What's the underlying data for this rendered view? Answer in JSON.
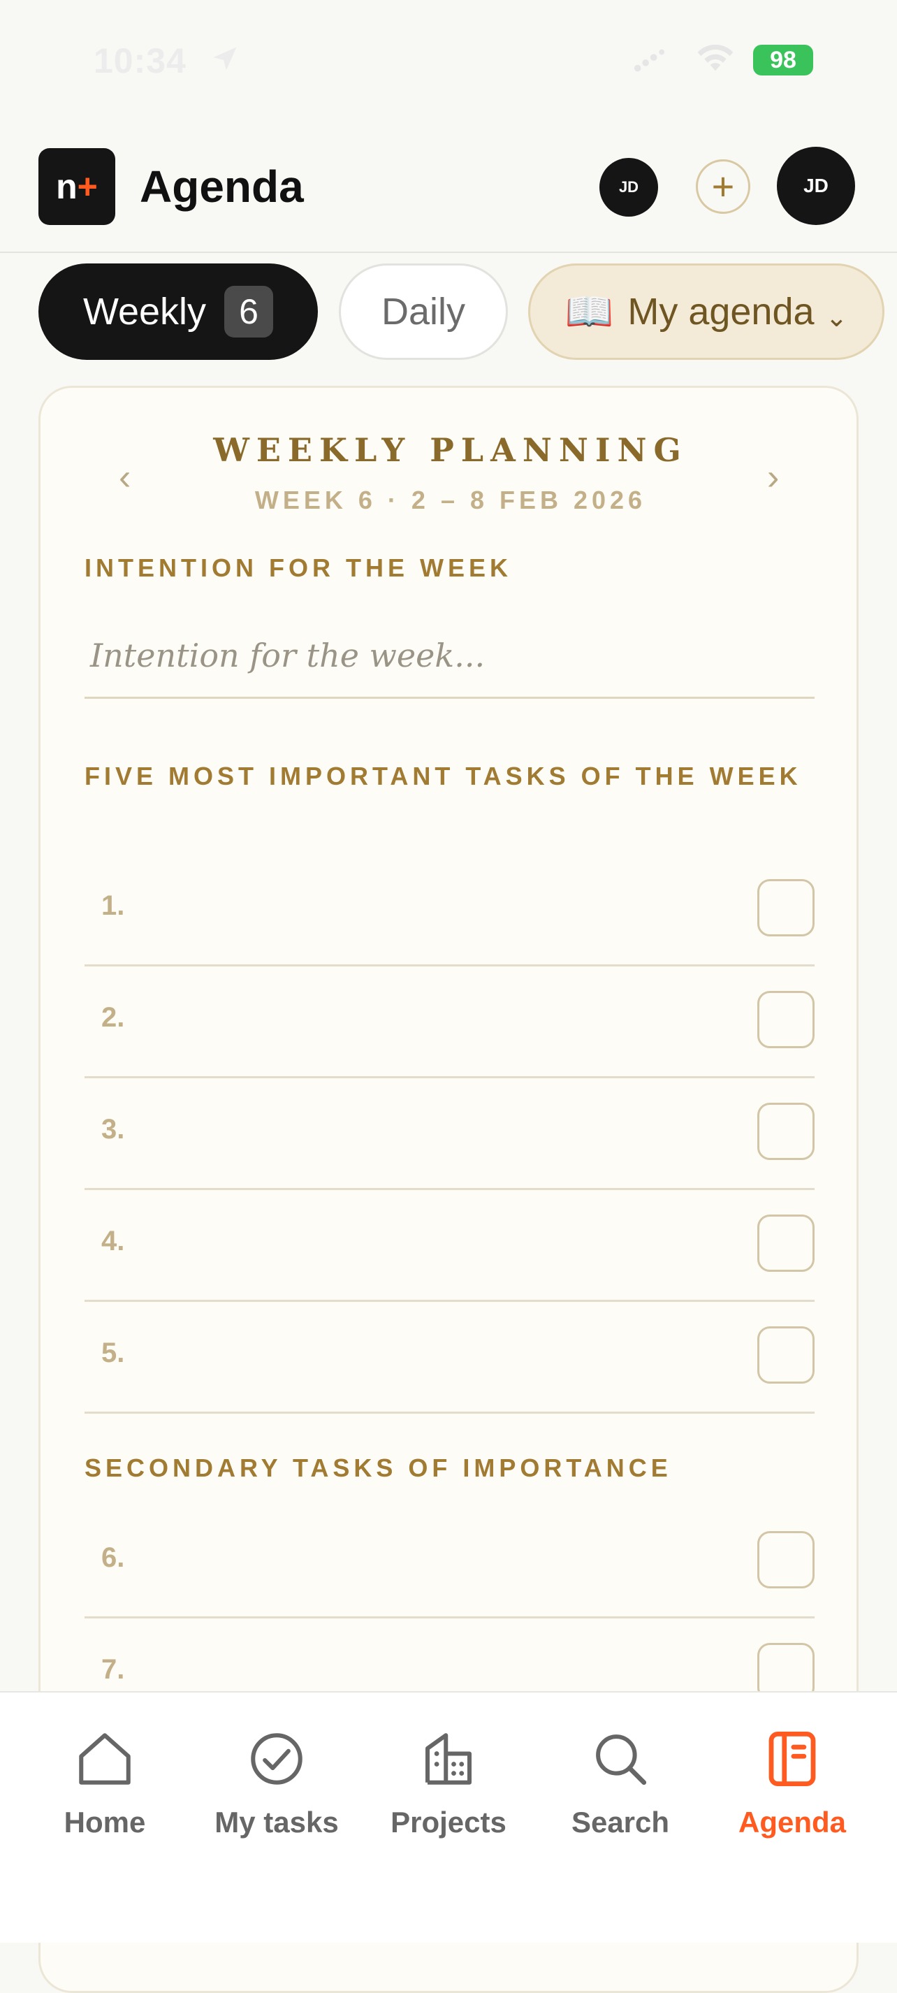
{
  "status_bar": {
    "time": "10:34",
    "battery": "98",
    "icons": [
      "location-icon",
      "cellular-icon",
      "wifi-icon",
      "battery-icon"
    ]
  },
  "header": {
    "logo_text": "n",
    "logo_plus": "+",
    "title": "Agenda",
    "avatar_small": "JD",
    "add_label": "+",
    "avatar_large": "JD"
  },
  "tabs": {
    "weekly": {
      "label": "Weekly",
      "badge": "6"
    },
    "daily": {
      "label": "Daily"
    },
    "agenda": {
      "icon": "📖",
      "label": "My agenda",
      "chevron": "⌄"
    }
  },
  "planner": {
    "prev": "‹",
    "next": "›",
    "title": "WEEKLY PLANNING",
    "subtitle": "WEEK 6 · 2 – 8 FEB 2026",
    "intention_heading": "INTENTION FOR THE WEEK",
    "intention_placeholder": "Intention for the week...",
    "top_tasks_heading": "FIVE MOST IMPORTANT TASKS OF THE WEEK",
    "top_tasks": [
      {
        "num": "1.",
        "checked": false
      },
      {
        "num": "2.",
        "checked": false
      },
      {
        "num": "3.",
        "checked": false
      },
      {
        "num": "4.",
        "checked": false
      },
      {
        "num": "5.",
        "checked": false
      }
    ],
    "secondary_heading": "SECONDARY TASKS OF IMPORTANCE",
    "secondary_tasks": [
      {
        "num": "6.",
        "checked": false
      },
      {
        "num": "7.",
        "checked": false
      }
    ]
  },
  "bottom_nav": {
    "items": [
      {
        "label": "Home",
        "icon": "home-icon"
      },
      {
        "label": "My tasks",
        "icon": "check-circle-icon"
      },
      {
        "label": "Projects",
        "icon": "building-icon"
      },
      {
        "label": "Search",
        "icon": "search-icon"
      },
      {
        "label": "Agenda",
        "icon": "agenda-book-icon",
        "active": true
      }
    ]
  },
  "colors": {
    "accent": "#ff5a1f",
    "gold": "#a27b32",
    "dark": "#151515"
  }
}
